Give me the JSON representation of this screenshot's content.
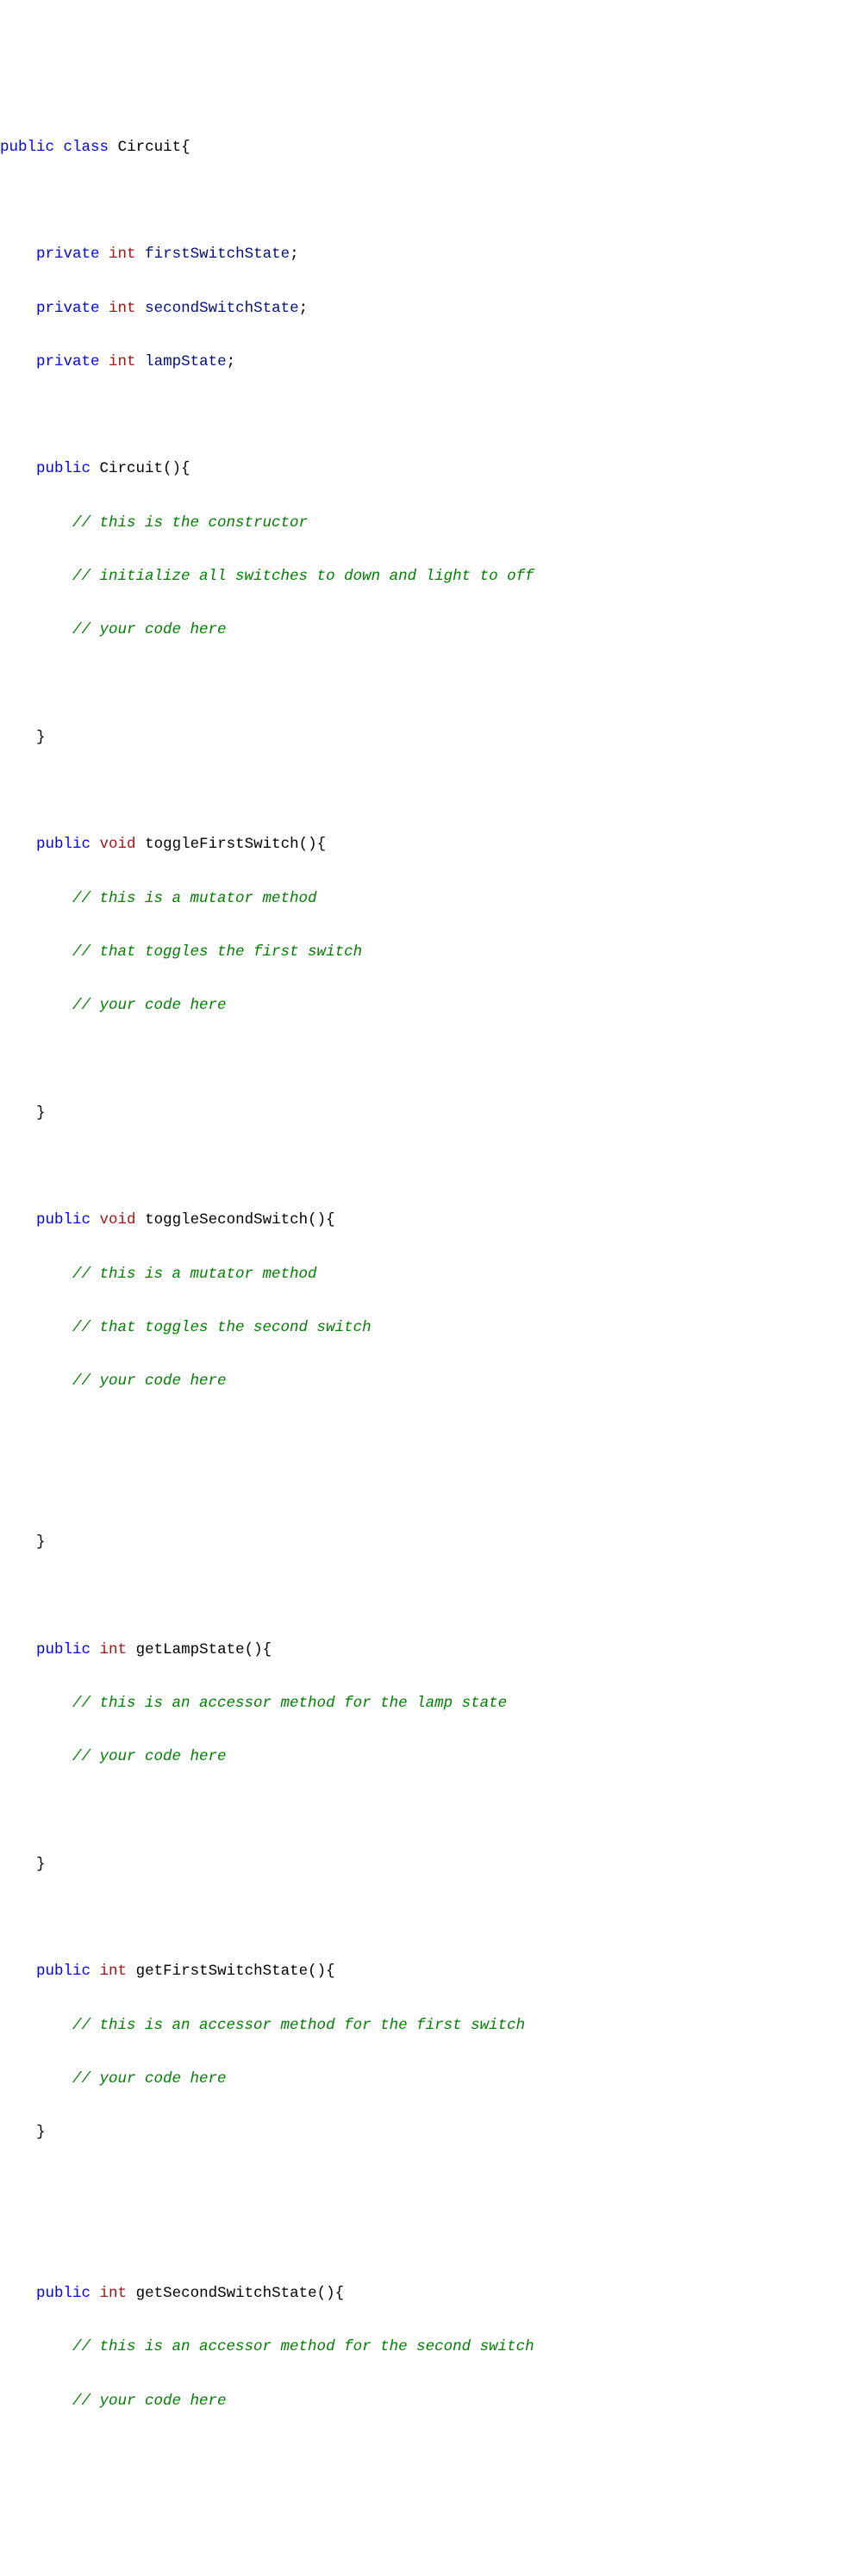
{
  "code": {
    "l1a": "public",
    "l1b": "class",
    "l1c": "Circuit{",
    "blank": "",
    "l3a": "private",
    "l3b": "int",
    "l3c": "firstSwitchState",
    "semi": ";",
    "l4c": "secondSwitchState",
    "l5c": "lampState",
    "l7a": "public",
    "l7b": "Circuit(){",
    "l8": "// this is the constructor",
    "l9": "// initialize all switches to down and light to off",
    "l10": "// your code here",
    "close": "}",
    "l14b": "void",
    "l14c": "toggleFirstSwitch(){",
    "l15": "// this is a mutator method",
    "l16": "// that toggles the first switch",
    "l21c": "toggleSecondSwitch(){",
    "l23": "// that toggles the second switch",
    "l29b": "int",
    "l29c": "getLampState(){",
    "l30": "// this is an accessor method for the lamp state",
    "l35c": "getFirstSwitchState(){",
    "l36": "// this is an accessor method for the first switch",
    "l41c": "getSecondSwitchState(){",
    "l42": "// this is an accessor method for the second switch"
  }
}
